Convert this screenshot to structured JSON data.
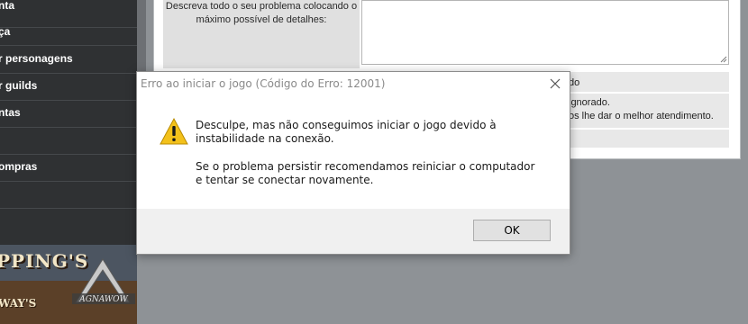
{
  "sidebar": {
    "items": [
      {
        "label": "nta"
      },
      {
        "label": "ça"
      },
      {
        "label": "r personagens"
      },
      {
        "label": "r guilds"
      },
      {
        "label": "ntas"
      },
      {
        "label": ""
      },
      {
        "label": "ompras"
      },
      {
        "label": ""
      }
    ]
  },
  "banner": {
    "line1": "PPING'S",
    "line2": "WAY'S",
    "logo_text": "AGNAWOW"
  },
  "form": {
    "description_label": "Descreva todo o seu problema colocando o máximo possível de detalhes:",
    "row1_text": "do",
    "row2_line1": "ignorado.",
    "row2_line2": "os lhe dar o melhor atendimento."
  },
  "dialog": {
    "title": "Erro ao iniciar o jogo (Código do Erro: 12001)",
    "message1": "Desculpe, mas não conseguimos iniciar o jogo devido à instabilidade na conexão.",
    "message2": "Se o problema persistir recomendamos reiniciar o computador e tentar se conectar novamente.",
    "ok_label": "OK",
    "icon": "warning-icon"
  },
  "colors": {
    "sidebar_bg": "#2f3133",
    "page_bg": "#8e9296",
    "warning_yellow": "#f3c11b"
  }
}
